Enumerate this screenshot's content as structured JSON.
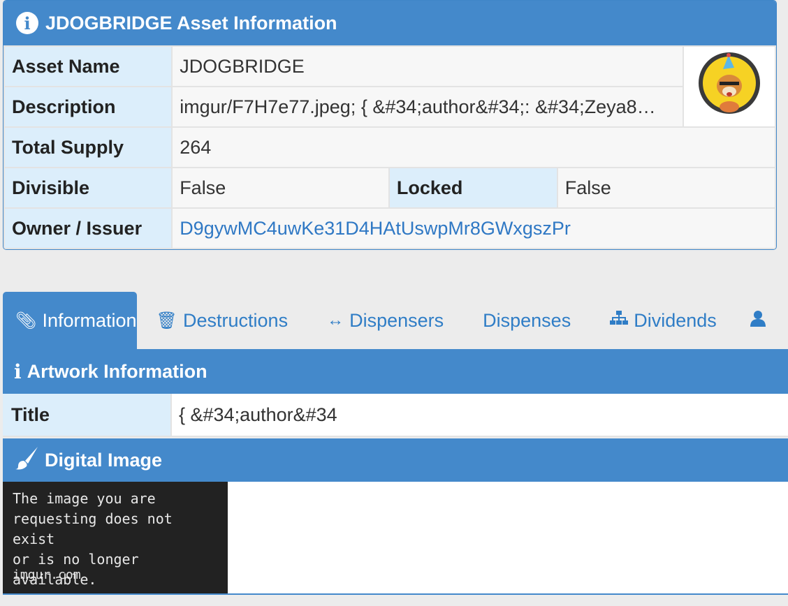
{
  "asset_panel": {
    "title": "JDOGBRIDGE Asset Information",
    "rows": {
      "asset_name_label": "Asset Name",
      "asset_name_value": "JDOGBRIDGE",
      "description_label": "Description",
      "description_value": "imgur/F7H7e77.jpeg; { &#34;author&#34;: &#34;Zeya8…",
      "total_supply_label": "Total Supply",
      "total_supply_value": "264",
      "divisible_label": "Divisible",
      "divisible_value": "False",
      "locked_label": "Locked",
      "locked_value": "False",
      "owner_label": "Owner / Issuer",
      "owner_value": "D9gywMC4uwKe31D4HAtUswpMr8GWxgszPr"
    }
  },
  "tabs": [
    {
      "label": "Information",
      "icon": "paperclip-icon"
    },
    {
      "label": "Destructions",
      "icon": "trash-icon"
    },
    {
      "label": "Dispensers",
      "icon": "arrows-horizontal-icon"
    },
    {
      "label": "Dispenses",
      "icon": ""
    },
    {
      "label": "Dividends",
      "icon": "sitemap-icon"
    }
  ],
  "artwork": {
    "header": "Artwork Information",
    "title_label": "Title",
    "title_value": "{ &#34;author&#34"
  },
  "digital_image": {
    "header": "Digital Image",
    "placeholder_lines": [
      "The image you are",
      "requesting does not exist",
      "or is no longer available."
    ],
    "placeholder_domain": "imgur.com"
  },
  "colors": {
    "header_blue": "#4489cb",
    "label_bg": "#dceefb",
    "link": "#2f78c4"
  }
}
